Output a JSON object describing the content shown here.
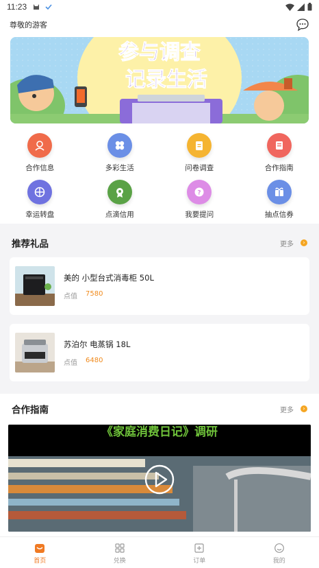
{
  "status_bar": {
    "time": "11:23"
  },
  "header": {
    "greeting": "尊敬的游客"
  },
  "banner": {
    "line1": "参与调查",
    "line2": "记录生活"
  },
  "grid": [
    {
      "label": "合作信息",
      "icon": "user-circle-icon",
      "color": "#f06b4a"
    },
    {
      "label": "多彩生活",
      "icon": "petals-icon",
      "color": "#6b8fe6"
    },
    {
      "label": "问卷调查",
      "icon": "clipboard-icon",
      "color": "#f5b431"
    },
    {
      "label": "合作指南",
      "icon": "guide-book-icon",
      "color": "#f0665e"
    },
    {
      "label": "幸运转盘",
      "icon": "spin-wheel-icon",
      "color": "#6f72e0"
    },
    {
      "label": "点滴信用",
      "icon": "medal-icon",
      "color": "#5aa246"
    },
    {
      "label": "我要提问",
      "icon": "question-bubble-icon",
      "color": "#dd8ce6"
    },
    {
      "label": "抽点信券",
      "icon": "gift-ticket-icon",
      "color": "#6b8fe6"
    }
  ],
  "gifts_section": {
    "title": "推荐礼品",
    "more": "更多"
  },
  "gifts": [
    {
      "name": "美的 小型台式消毒柜 50L",
      "price_label": "点值",
      "price": "7580"
    },
    {
      "name": "苏泊尔 电蒸锅 18L",
      "price_label": "点值",
      "price": "6480"
    }
  ],
  "guide_section": {
    "title": "合作指南",
    "more": "更多"
  },
  "video": {
    "title": "《家庭消费日记》调研"
  },
  "tabs": [
    {
      "label": "首页",
      "icon": "home-icon",
      "active": true
    },
    {
      "label": "兑换",
      "icon": "grid-apps-icon",
      "active": false
    },
    {
      "label": "订单",
      "icon": "order-icon",
      "active": false
    },
    {
      "label": "我的",
      "icon": "profile-icon",
      "active": false
    }
  ]
}
